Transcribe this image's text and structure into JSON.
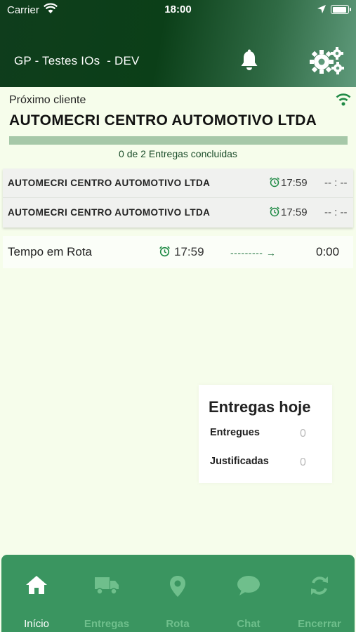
{
  "status_bar": {
    "carrier": "Carrier",
    "time": "18:00"
  },
  "header": {
    "title": "GP - Testes IOs  - DEV",
    "icons": [
      "bell-icon",
      "gears-icon"
    ]
  },
  "next_client": {
    "label": "Próximo cliente",
    "name": "AUTOMECRI CENTRO AUTOMOTIVO LTDA",
    "progress_fraction": 0,
    "progress_text": "0 de 2 Entregas concluidas"
  },
  "deliveries": [
    {
      "name": "AUTOMECRI CENTRO AUTOMOTIVO LTDA",
      "time": "17:59",
      "end": "-- : --"
    },
    {
      "name": "AUTOMECRI CENTRO AUTOMOTIVO LTDA",
      "time": "17:59",
      "end": "-- : --"
    }
  ],
  "route": {
    "label": "Tempo em Rota",
    "start": "17:59",
    "arrow": "--------- →",
    "elapsed": "0:00"
  },
  "today": {
    "title": "Entregas hoje",
    "rows": [
      {
        "label": "Entregues",
        "value": "0"
      },
      {
        "label": "Justificadas",
        "value": "0"
      }
    ]
  },
  "tabs": [
    {
      "label": "Início",
      "icon": "home-icon",
      "active": true
    },
    {
      "label": "Entregas",
      "icon": "truck-icon",
      "active": false
    },
    {
      "label": "Rota",
      "icon": "map-pin-icon",
      "active": false
    },
    {
      "label": "Chat",
      "icon": "chat-icon",
      "active": false
    },
    {
      "label": "Encerrar",
      "icon": "sync-icon",
      "active": false
    }
  ],
  "colors": {
    "header_dark": "#0b3f18",
    "accent": "#3a9560",
    "progress_track": "#a6c8a8",
    "background": "#f6fdeb"
  }
}
